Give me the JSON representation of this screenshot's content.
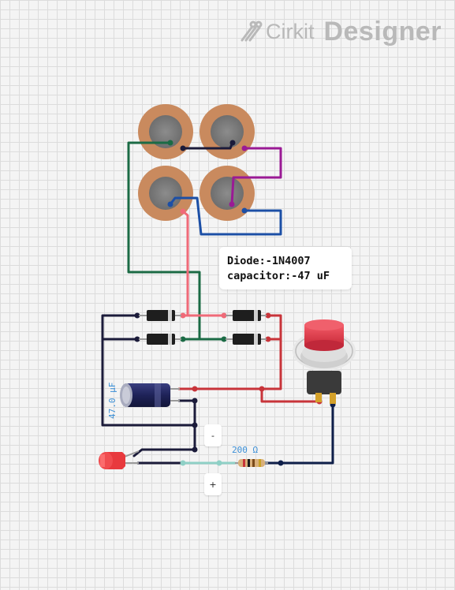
{
  "logo": {
    "brand": "Cirkit",
    "product": "Designer",
    "icon": "cirkit-logo-icon"
  },
  "note": {
    "line1": "Diode:-1N4007",
    "line2": "capacitor:-47 uF"
  },
  "capacitor": {
    "label": "47.0 µF"
  },
  "resistor": {
    "label": "200 Ω"
  },
  "battery": {
    "neg_label": "-",
    "pos_label": "+"
  },
  "colors": {
    "black_wire": "#1b1b3a",
    "green_wire": "#1b6b45",
    "red_wire": "#c8343a",
    "pink_wire": "#f06a78",
    "purple_wire": "#9a1a95",
    "blue_wire": "#1c4fa6",
    "navy_wire": "#0f1f4a",
    "teal_wire": "#8fd0c6",
    "piezo_ring": "#c98a5e",
    "button_cap": "#e03b4b"
  }
}
